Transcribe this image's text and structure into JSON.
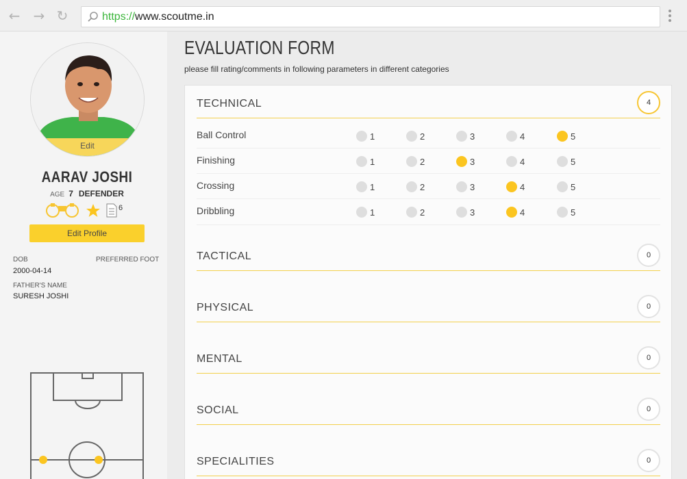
{
  "browser": {
    "url_scheme": "https://",
    "url_host": "www.scoutme.in"
  },
  "profile": {
    "avatar_edit": "Edit",
    "name": "AARAV JOSHI",
    "age_label": "AGE",
    "age": "7",
    "position": "DEFENDER",
    "doc_count": "6",
    "edit_profile": "Edit Profile",
    "dob_label": "DOB",
    "dob": "2000-04-14",
    "foot_label": "PREFERRED FOOT",
    "father_label": "FATHER'S NAME",
    "father": "SURESH JOSHI"
  },
  "colors": {
    "accent": "#fad02c",
    "selected": "#fbc520",
    "unselected": "#dedede"
  },
  "form": {
    "title": "EVALUATION FORM",
    "subtitle": "please fill rating/comments in following parameters in different categories",
    "scale": [
      "1",
      "2",
      "3",
      "4",
      "5"
    ],
    "categories": [
      {
        "title": "TECHNICAL",
        "score": "4"
      },
      {
        "title": "TACTICAL",
        "score": "0"
      },
      {
        "title": "PHYSICAL",
        "score": "0"
      },
      {
        "title": "MENTAL",
        "score": "0"
      },
      {
        "title": "SOCIAL",
        "score": "0"
      },
      {
        "title": "SPECIALITIES",
        "score": "0"
      }
    ],
    "technical_rows": [
      {
        "label": "Ball Control",
        "selected": 5
      },
      {
        "label": "Finishing",
        "selected": 3
      },
      {
        "label": "Crossing",
        "selected": 4
      },
      {
        "label": "Dribbling",
        "selected": 4
      }
    ]
  }
}
